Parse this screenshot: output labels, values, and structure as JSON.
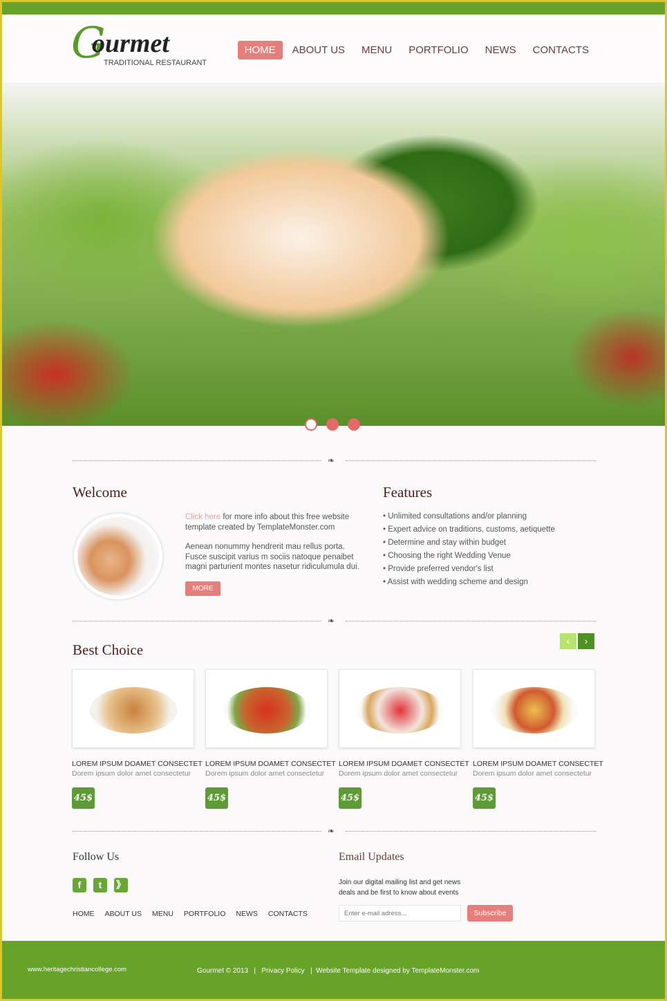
{
  "brand": {
    "logo_text": "Gourmet",
    "tagline": "TRADITIONAL RESTAURANT"
  },
  "nav": [
    {
      "label": "HOME",
      "active": true
    },
    {
      "label": "ABOUT US"
    },
    {
      "label": "MENU"
    },
    {
      "label": "PORTFOLIO"
    },
    {
      "label": "NEWS"
    },
    {
      "label": "CONTACTS"
    }
  ],
  "slider": {
    "slides": 3,
    "active": 1
  },
  "welcome": {
    "title": "Welcome",
    "link": "Click here",
    "text1": " for more info about this free website template created by TemplateMonster.com",
    "text2": "Aenean nonummy hendrerit mau rellus porta. Fusce suscipit varius m sociis natoque penaibet magni parturient montes nasetur ridiculumula dui.",
    "more": "MORE"
  },
  "features": {
    "title": "Features",
    "items": [
      "Unlimited consultations and/or planning",
      "Expert advice on traditions, customs, aetiquette",
      "Determine and stay within budget",
      "Choosing the right Wedding Venue",
      "Provide preferred vendor's list",
      "Assist with wedding scheme and design"
    ]
  },
  "best_choice": {
    "title": "Best Choice",
    "prev": "‹",
    "next": "›",
    "items": [
      {
        "title": "LOREM IPSUM DOAMET CONSECTET",
        "desc": "Dorem ipsum dolor amet consectetur",
        "price": "45$"
      },
      {
        "title": "LOREM IPSUM DOAMET CONSECTET",
        "desc": "Dorem ipsum dolor amet consectetur",
        "price": "45$"
      },
      {
        "title": "LOREM IPSUM DOAMET CONSECTET",
        "desc": "Dorem ipsum dolor amet consectetur",
        "price": "45$"
      },
      {
        "title": "LOREM IPSUM DOAMET CONSECTET",
        "desc": "Dorem ipsum dolor amet consectetur",
        "price": "45$"
      }
    ]
  },
  "follow": {
    "title": "Follow Us",
    "icons": [
      "facebook-icon",
      "twitter-icon",
      "rss-icon"
    ],
    "links": [
      "HOME",
      "ABOUT US",
      "MENU",
      "PORTFOLIO",
      "NEWS",
      "CONTACTS"
    ]
  },
  "email": {
    "title": "Email Updates",
    "text": "Join our digital mailing list and get news deals and be first to know about events",
    "placeholder": "Enter e-mail adress...",
    "button": "Subscribe"
  },
  "footer": {
    "watermark": "www.heritagechristiancollege.com",
    "copyright": "Gourmet © 2013",
    "privacy": "Privacy Policy",
    "credit": "Website Template designed by TemplateMonster.com"
  },
  "colors": {
    "green": "#66a328",
    "accent": "#e57f7d",
    "border": "#d6c832"
  }
}
